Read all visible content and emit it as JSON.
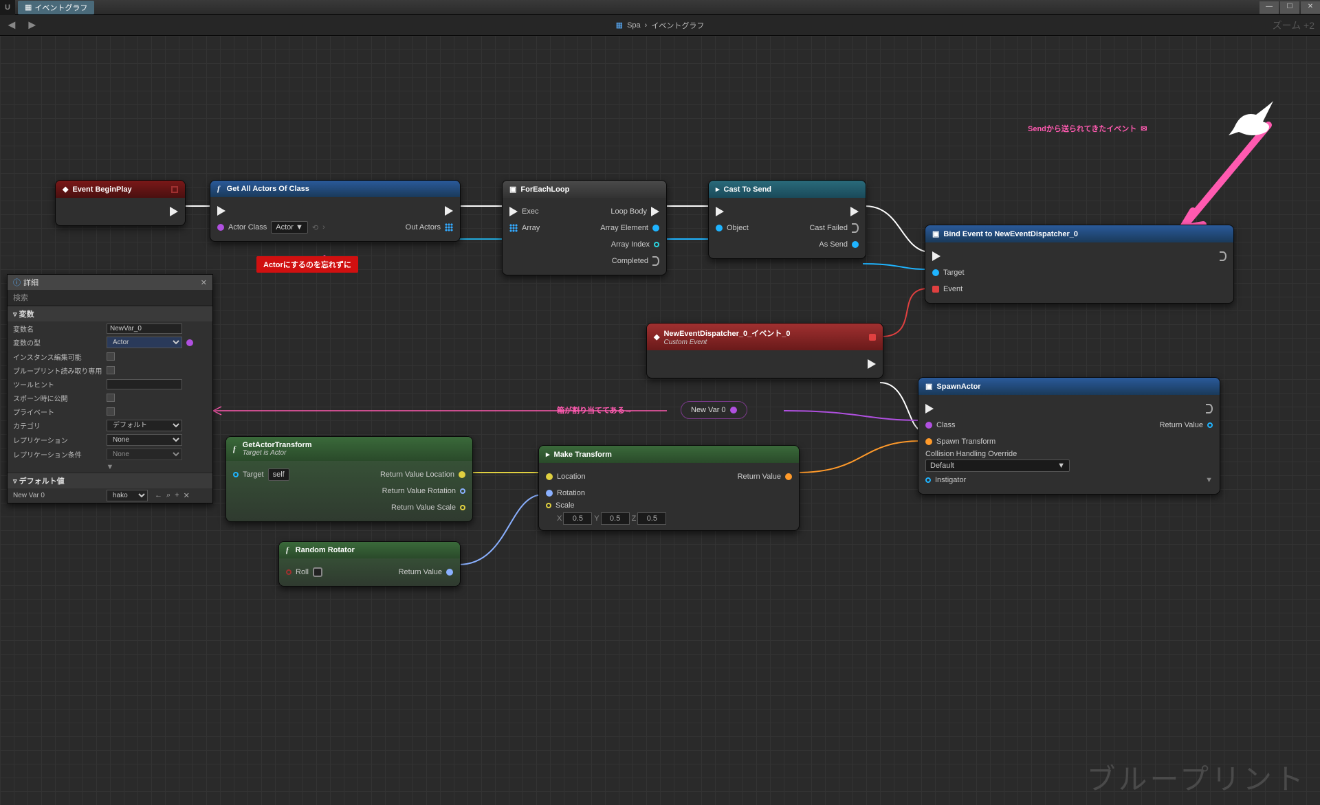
{
  "window": {
    "tab": "イベントグラフ"
  },
  "toolbar": {
    "bp_name": "Spa",
    "crumb": "イベントグラフ",
    "zoom": "ズーム +2"
  },
  "watermark": "ブループリント",
  "annotations": {
    "send_event": "Sendから送られてきたイベント",
    "actor_reminder": "Actorにするのを忘れずに",
    "box_assigned": "箱が割り当ててある→"
  },
  "nodes": {
    "begin_play": {
      "title": "Event BeginPlay"
    },
    "get_actors": {
      "title": "Get All Actors Of Class",
      "actor_class_lbl": "Actor Class",
      "actor_class_val": "Actor",
      "out_actors": "Out Actors"
    },
    "foreach": {
      "title": "ForEachLoop",
      "exec": "Exec",
      "array": "Array",
      "loop_body": "Loop Body",
      "array_elem": "Array Element",
      "array_idx": "Array Index",
      "completed": "Completed"
    },
    "cast": {
      "title": "Cast To Send",
      "object": "Object",
      "cast_failed": "Cast Failed",
      "as_send": "As Send"
    },
    "bind": {
      "title": "Bind Event to NewEventDispatcher_0",
      "target": "Target",
      "event": "Event"
    },
    "custom_event": {
      "title": "NewEventDispatcher_0_イベント_0",
      "sub": "Custom Event"
    },
    "spawn": {
      "title": "SpawnActor",
      "class": "Class",
      "transform": "Spawn Transform",
      "collision_lbl": "Collision Handling Override",
      "collision_val": "Default",
      "instigator": "Instigator",
      "return": "Return Value"
    },
    "get_transform": {
      "title": "GetActorTransform",
      "sub": "Target is Actor",
      "target": "Target",
      "self": "self",
      "rv_loc": "Return Value Location",
      "rv_rot": "Return Value Rotation",
      "rv_scale": "Return Value Scale"
    },
    "make_transform": {
      "title": "Make Transform",
      "location": "Location",
      "rotation": "Rotation",
      "scale": "Scale",
      "return": "Return Value",
      "sx": "0.5",
      "sy": "0.5",
      "sz": "0.5"
    },
    "random_rotator": {
      "title": "Random Rotator",
      "roll": "Roll",
      "return": "Return Value"
    },
    "newvar_pill": "New Var 0"
  },
  "details": {
    "title": "詳細",
    "search": "検索",
    "sec_var": "変数",
    "rows": {
      "name_lbl": "変数名",
      "name_val": "NewVar_0",
      "type_lbl": "変数の型",
      "type_val": "Actor",
      "inst_lbl": "インスタンス編集可能",
      "ro_lbl": "ブループリント読み取り専用",
      "tooltip_lbl": "ツールヒント",
      "spawn_lbl": "スポーン時に公開",
      "private_lbl": "プライベート",
      "category_lbl": "カテゴリ",
      "category_val": "デフォルト",
      "rep_lbl": "レプリケーション",
      "rep_val": "None",
      "repcond_lbl": "レプリケーション条件",
      "repcond_val": "None"
    },
    "sec_default": "デフォルト値",
    "default_lbl": "New Var 0",
    "default_val": "hako"
  }
}
